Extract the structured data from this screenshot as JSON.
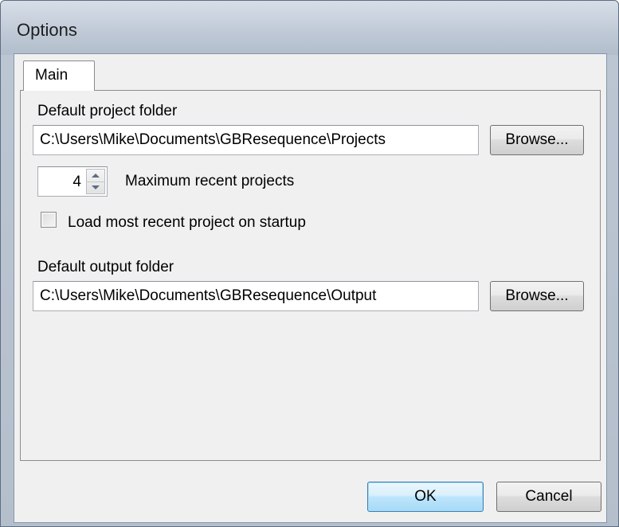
{
  "window": {
    "title": "Options"
  },
  "tabs": [
    {
      "label": "Main",
      "selected": true
    }
  ],
  "main": {
    "project_folder_label": "Default project folder",
    "project_folder_value": "C:\\Users\\Mike\\Documents\\GBResequence\\Projects",
    "browse_label": "Browse...",
    "max_recent_value": "4",
    "max_recent_label": "Maximum recent projects",
    "load_recent_label": "Load most recent project on startup",
    "load_recent_checked": false,
    "output_folder_label": "Default output folder",
    "output_folder_value": "C:\\Users\\Mike\\Documents\\GBResequence\\Output"
  },
  "footer": {
    "ok_label": "OK",
    "cancel_label": "Cancel"
  },
  "icons": {
    "spin_up": "spin-up-arrow-icon",
    "spin_down": "spin-down-arrow-icon"
  },
  "colors": {
    "title_bar": "#bfc9d6",
    "dialog_face": "#f0f0f0",
    "default_button": "#bee6fd"
  }
}
